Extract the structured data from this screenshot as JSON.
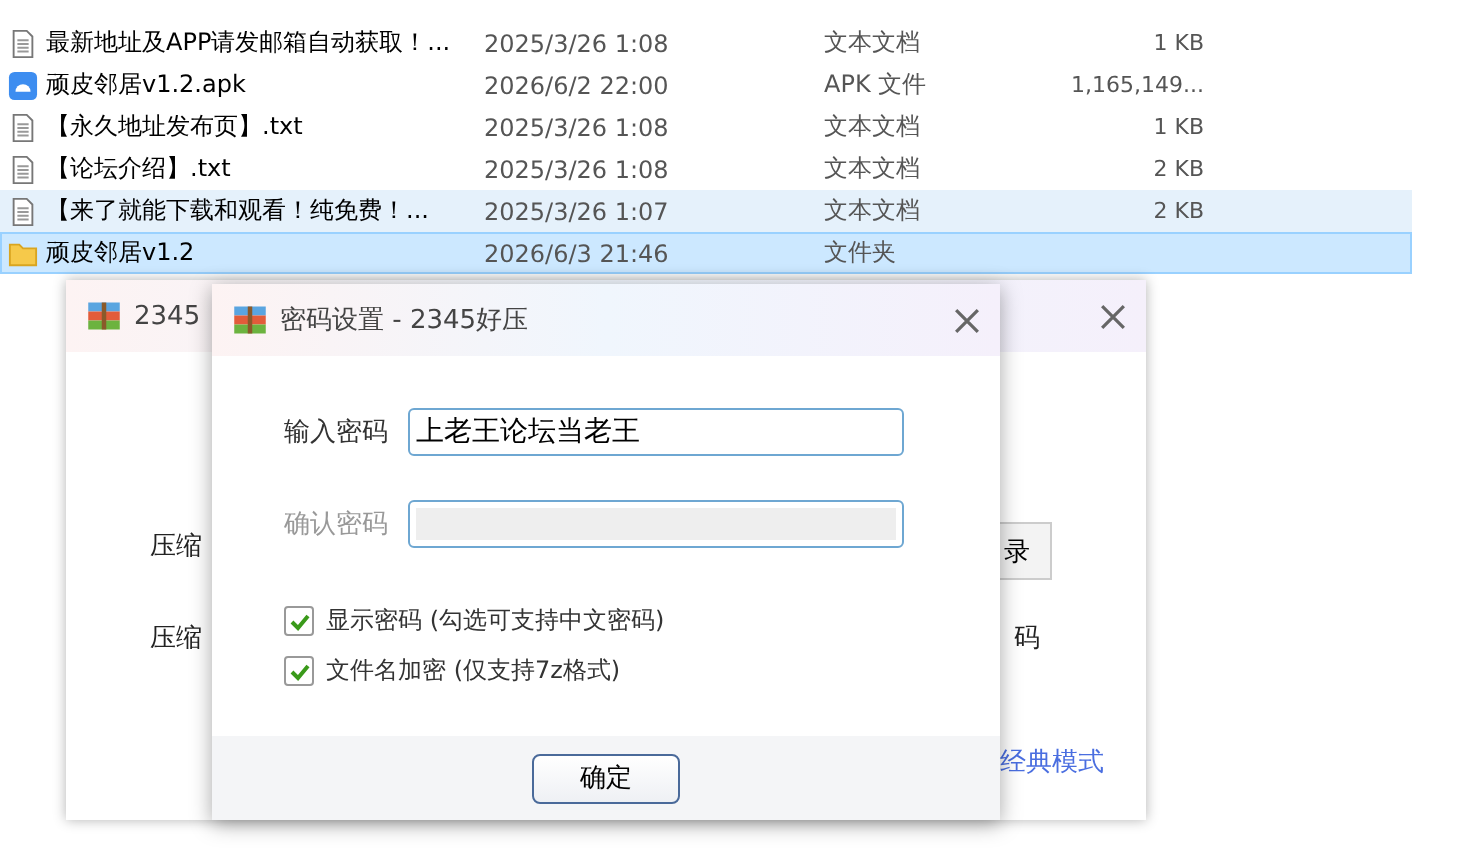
{
  "file_list": {
    "rows": [
      {
        "kind": "text",
        "name": "最新地址及APP请发邮箱自动获取！...",
        "date": "2025/3/26 1:08",
        "type": "文本文档",
        "size": "1 KB",
        "selected": false,
        "hovered": false
      },
      {
        "kind": "apk",
        "name": "顽皮邻居v1.2.apk",
        "date": "2026/6/2 22:00",
        "type": "APK 文件",
        "size": "1,165,149...",
        "selected": false,
        "hovered": false
      },
      {
        "kind": "text",
        "name": "【永久地址发布页】.txt",
        "date": "2025/3/26 1:08",
        "type": "文本文档",
        "size": "1 KB",
        "selected": false,
        "hovered": false
      },
      {
        "kind": "text",
        "name": "【论坛介绍】.txt",
        "date": "2025/3/26 1:08",
        "type": "文本文档",
        "size": "2 KB",
        "selected": false,
        "hovered": false
      },
      {
        "kind": "text",
        "name": "【来了就能下载和观看！纯免费！...",
        "date": "2025/3/26 1:07",
        "type": "文本文档",
        "size": "2 KB",
        "selected": false,
        "hovered": true
      },
      {
        "kind": "folder",
        "name": "顽皮邻居v1.2",
        "date": "2026/6/3 21:46",
        "type": "文件夹",
        "selected": true,
        "hovered": false
      }
    ]
  },
  "back_window": {
    "title": "2345",
    "row_1_label": "压缩",
    "row_1_button": "录",
    "row_2_label": "压缩",
    "row_2_right": "码",
    "link": "经典模式"
  },
  "dialog": {
    "title": "密码设置 - 2345好压",
    "fields": [
      {
        "label": "输入密码",
        "value": "上老王论坛当老王",
        "disabled": false
      },
      {
        "label": "确认密码",
        "disabled": true
      }
    ],
    "checkboxes": [
      {
        "label": "显示密码 (勾选可支持中文密码)",
        "checked": true
      },
      {
        "label": "文件名加密  (仅支持7z格式)",
        "checked": true
      }
    ],
    "ok_button": "确定"
  }
}
